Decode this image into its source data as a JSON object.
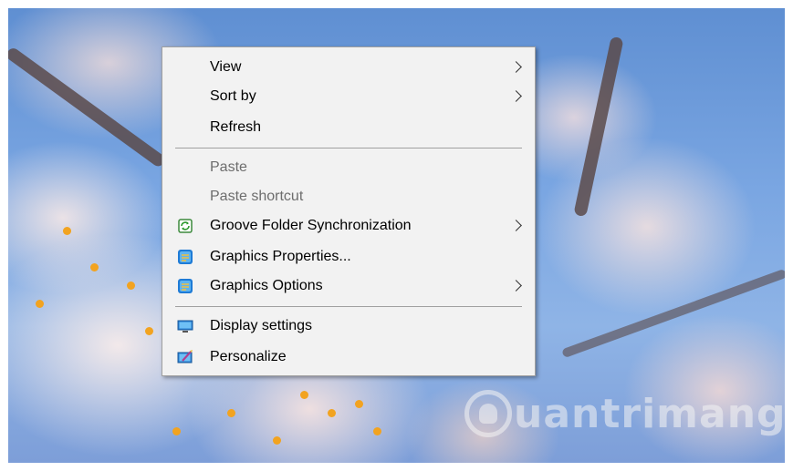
{
  "context_menu": {
    "items": [
      {
        "label": "View"
      },
      {
        "label": "Sort by"
      },
      {
        "label": "Refresh"
      },
      {
        "label": "Paste"
      },
      {
        "label": "Paste shortcut"
      },
      {
        "label": "Groove Folder Synchronization",
        "icon": "groove-sync-icon"
      },
      {
        "label": "Graphics Properties...",
        "icon": "intel-graphics-icon"
      },
      {
        "label": "Graphics Options",
        "icon": "intel-graphics-icon"
      },
      {
        "label": "Display settings",
        "icon": "display-settings-icon"
      },
      {
        "label": "Personalize",
        "icon": "personalize-icon"
      }
    ]
  },
  "watermark": {
    "text": "uantrimang"
  },
  "colors": {
    "menu_background": "#f2f2f2",
    "menu_border": "#a0a0a0",
    "disabled_text": "#6d6d6d",
    "sky_blue": "#7aa6e2"
  }
}
